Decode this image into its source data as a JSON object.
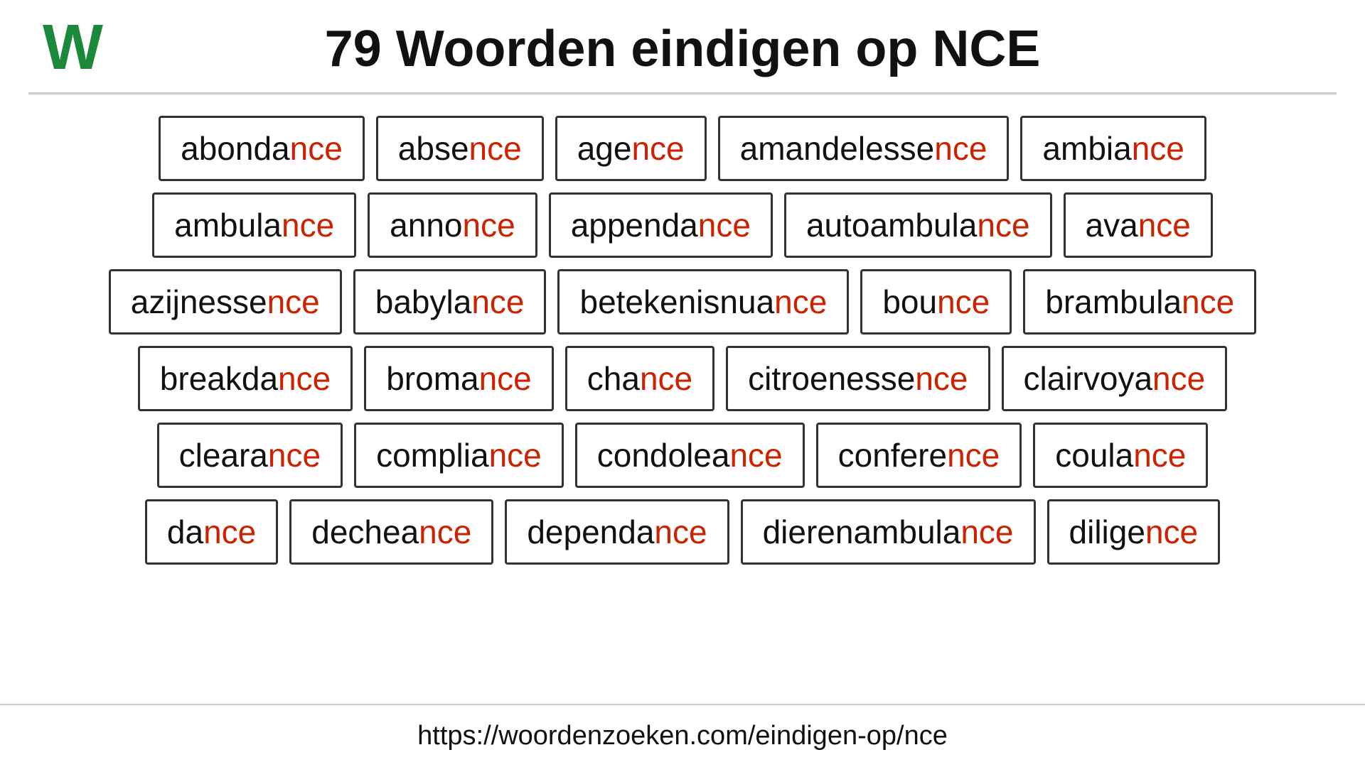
{
  "header": {
    "logo": "W",
    "title": "79 Woorden eindigen op NCE"
  },
  "words": [
    [
      {
        "prefix": "abonda",
        "suffix": "nce"
      },
      {
        "prefix": "abse",
        "suffix": "nce"
      },
      {
        "prefix": "age",
        "suffix": "nce"
      },
      {
        "prefix": "amandelesse",
        "suffix": "nce"
      },
      {
        "prefix": "ambia",
        "suffix": "nce"
      }
    ],
    [
      {
        "prefix": "ambula",
        "suffix": "nce"
      },
      {
        "prefix": "anno",
        "suffix": "nce"
      },
      {
        "prefix": "appenda",
        "suffix": "nce"
      },
      {
        "prefix": "autoambula",
        "suffix": "nce"
      },
      {
        "prefix": "ava",
        "suffix": "nce"
      }
    ],
    [
      {
        "prefix": "azijnesse",
        "suffix": "nce"
      },
      {
        "prefix": "babyla",
        "suffix": "nce"
      },
      {
        "prefix": "betekenisnua",
        "suffix": "nce"
      },
      {
        "prefix": "bou",
        "suffix": "nce"
      },
      {
        "prefix": "brambula",
        "suffix": "nce"
      }
    ],
    [
      {
        "prefix": "breakda",
        "suffix": "nce"
      },
      {
        "prefix": "broma",
        "suffix": "nce"
      },
      {
        "prefix": "cha",
        "suffix": "nce"
      },
      {
        "prefix": "citroenesse",
        "suffix": "nce"
      },
      {
        "prefix": "clairvoya",
        "suffix": "nce"
      }
    ],
    [
      {
        "prefix": "cleara",
        "suffix": "nce"
      },
      {
        "prefix": "complia",
        "suffix": "nce"
      },
      {
        "prefix": "condolea",
        "suffix": "nce"
      },
      {
        "prefix": "confere",
        "suffix": "nce"
      },
      {
        "prefix": "coula",
        "suffix": "nce"
      }
    ],
    [
      {
        "prefix": "da",
        "suffix": "nce"
      },
      {
        "prefix": "dechea",
        "suffix": "nce"
      },
      {
        "prefix": "dependa",
        "suffix": "nce"
      },
      {
        "prefix": "dierenambula",
        "suffix": "nce"
      },
      {
        "prefix": "dilige",
        "suffix": "nce"
      }
    ]
  ],
  "footer": {
    "url": "https://woordenzoeken.com/eindigen-op/nce"
  }
}
